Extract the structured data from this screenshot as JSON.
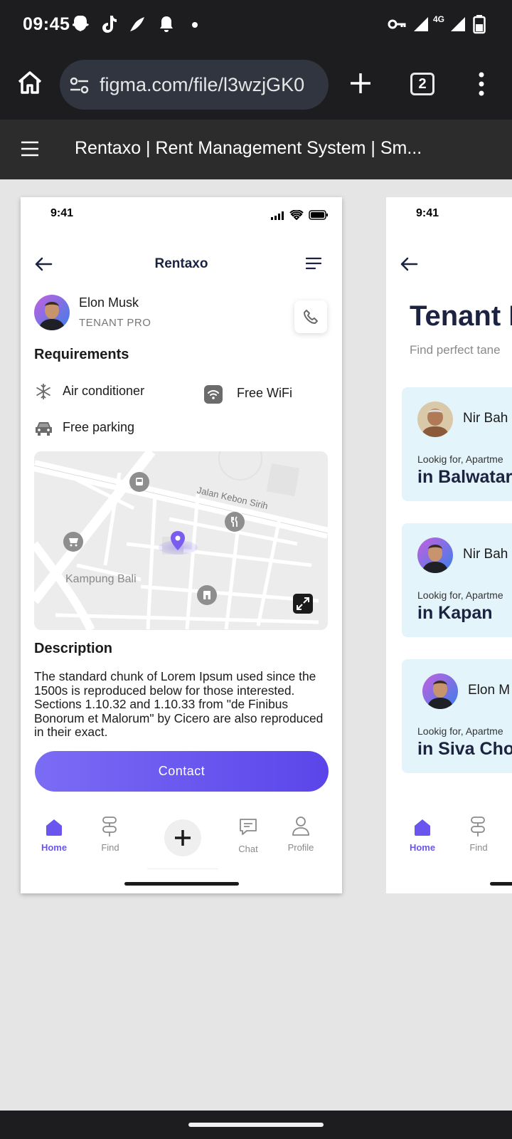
{
  "status_bar": {
    "time": "09:45",
    "network": "4G"
  },
  "browser": {
    "url": "figma.com/file/l3wzjGK0",
    "tab_count": "2"
  },
  "figma": {
    "title": "Rentaxo | Rent Management System | Sm..."
  },
  "detail_screen": {
    "phone_time": "9:41",
    "app_title": "Rentaxo",
    "user": {
      "name": "Elon Musk",
      "role": "TENANT PRO"
    },
    "requirements_heading": "Requirements",
    "requirements": [
      {
        "label": "Air conditioner",
        "icon": "snowflake-icon"
      },
      {
        "label": "Free WiFi",
        "icon": "wifi-icon"
      },
      {
        "label": "Free parking",
        "icon": "car-icon"
      }
    ],
    "map": {
      "street_label": "Jalan Kebon Sirih",
      "area_label": "Kampung Bali"
    },
    "description_heading": "Description",
    "description": "The standard chunk of Lorem Ipsum used since the 1500s is reproduced below for those interested. Sections 1.10.32 and 1.10.33 from \"de Finibus Bonorum et Malorum\" by Cicero are also reproduced in their exact.",
    "contact_label": "Contact",
    "nav": {
      "home": "Home",
      "find": "Find",
      "chat": "Chat",
      "profile": "Profile"
    }
  },
  "list_screen": {
    "phone_time": "9:41",
    "title": "Tenant I",
    "subtitle": "Find perfect tane",
    "cards": [
      {
        "name": "Nir Bah",
        "looking": "Lookig for, Apartme",
        "location": "in Balwatar"
      },
      {
        "name": "Nir Bah",
        "looking": "Lookig for, Apartme",
        "location": "in Kapan"
      },
      {
        "name": "Elon M",
        "looking": "Lookig for, Apartme",
        "location": "in Siva Cho"
      }
    ],
    "nav": {
      "home": "Home",
      "find": "Find"
    }
  },
  "colors": {
    "accent": "#6a56ee",
    "navy": "#1c2340",
    "card_bg": "#e4f4fb",
    "chrome": "#1d1d1f"
  }
}
